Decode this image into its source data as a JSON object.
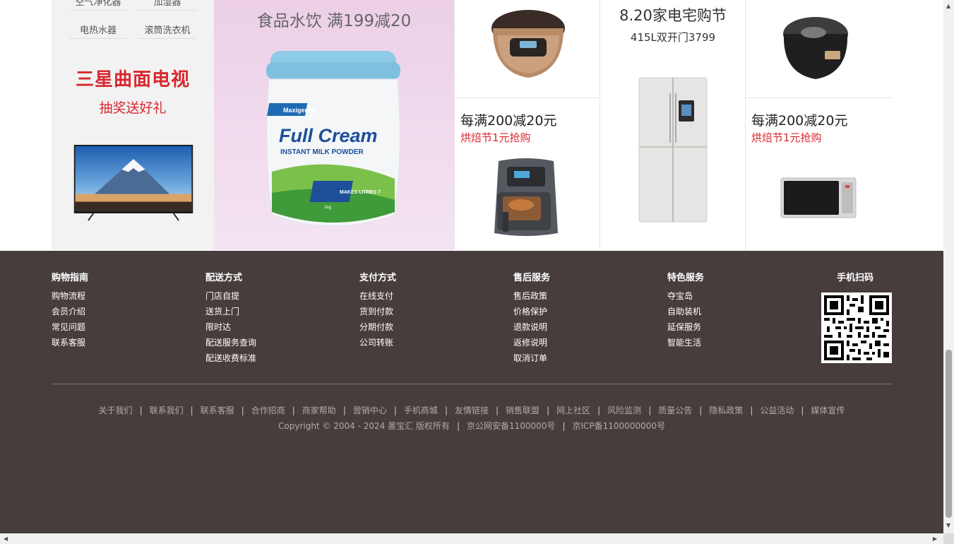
{
  "promo": {
    "category_links": [
      "空气净化器",
      "加湿器",
      "电热水器",
      "滚筒洗衣机"
    ],
    "samsung_title": "三星曲面电视",
    "samsung_subtitle": "抽奖送好礼",
    "milk_title": "食品水饮  满199减20",
    "milk_brand": "Maxigenes",
    "milk_name_line1": "Full Cream",
    "milk_name_line2": "INSTANT MILK POWDER",
    "milk_makes": "MAKES LITRES 7",
    "milk_weight": "1kg",
    "cell_airfryer_title": "每满200减20元",
    "cell_airfryer_sub": "烘焙节1元抢购",
    "cell_oven_title": "每满200减20元",
    "cell_oven_sub": "烘焙节1元抢购",
    "fridge_title": "8.20家电宅购节",
    "fridge_subtitle": "415L双开门3799"
  },
  "footer": {
    "columns": [
      {
        "heading": "购物指南",
        "items": [
          "购物流程",
          "会员介绍",
          "常见问题",
          "联系客服"
        ]
      },
      {
        "heading": "配送方式",
        "items": [
          "门店自提",
          "送货上门",
          "限时达",
          "配送服务查询",
          "配送收费标准"
        ]
      },
      {
        "heading": "支付方式",
        "items": [
          "在线支付",
          "货到付款",
          "分期付款",
          "公司转账"
        ]
      },
      {
        "heading": "售后服务",
        "items": [
          "售后政策",
          "价格保护",
          "退款说明",
          "返修说明",
          "取消订单"
        ]
      },
      {
        "heading": "特色服务",
        "items": [
          "夺宝岛",
          "自助装机",
          "延保服务",
          "智能生活"
        ]
      }
    ],
    "qr_heading": "手机扫码",
    "bottom_links": [
      "关于我们",
      "联系我们",
      "联系客服",
      "合作招商",
      "商家帮助",
      "营销中心",
      "手机商城",
      "友情链接",
      "销售联盟",
      "网上社区",
      "风险监测",
      "质量公告",
      "隐私政策",
      "公益活动",
      "媒体宣传"
    ],
    "copyright": "Copyright © 2004 - 2024 墨宝汇 版权所有",
    "police_record": "京公网安备1100000号",
    "icp_record": "京ICP备1100000000号"
  },
  "colors": {
    "footer_bg": "#483d3d",
    "accent_red": "#d8282f",
    "milk_bg": "#eccfe6"
  },
  "icons": [
    "rice-cooker-image",
    "pressure-cooker-image",
    "air-fryer-image",
    "microwave-oven-image",
    "refrigerator-image",
    "tv-image",
    "milk-powder-image",
    "qr-code"
  ]
}
